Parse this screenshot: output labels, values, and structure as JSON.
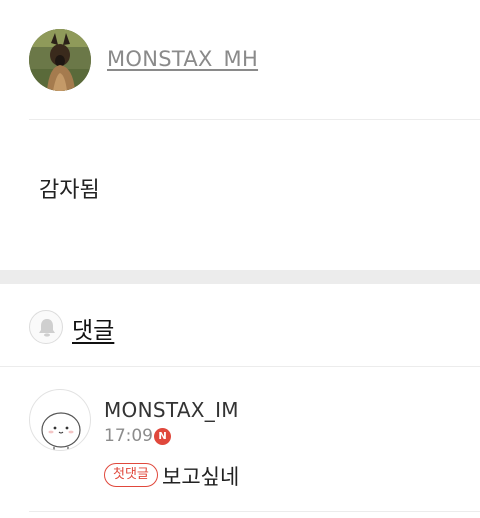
{
  "post": {
    "author": "MONSTAX_MH",
    "body": "감자됨"
  },
  "comments_section": {
    "title": "댓글"
  },
  "comments": [
    {
      "author": "MONSTAX_IM",
      "time": "17:09",
      "new_badge": "N",
      "tag": "첫댓글",
      "text": "보고싶네"
    }
  ],
  "colors": {
    "accent": "#e0483c",
    "divider": "#ececec",
    "section_gap": "#ececec"
  }
}
